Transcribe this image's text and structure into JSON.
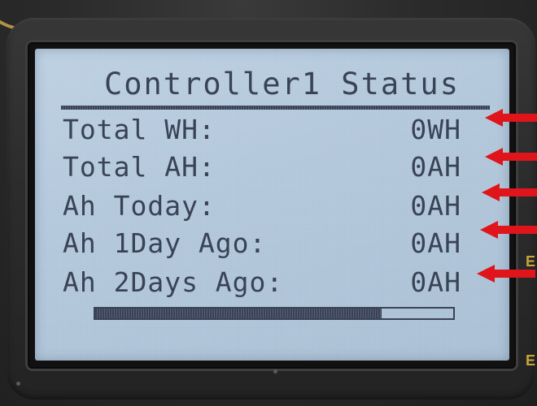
{
  "device": {
    "screen_title": "Controller1 Status",
    "rows": [
      {
        "label": "Total WH:",
        "value": "0WH"
      },
      {
        "label": "Total AH:",
        "value": "0AH"
      },
      {
        "label": "Ah Today:",
        "value": "0AH"
      },
      {
        "label": "Ah 1Day Ago:",
        "value": "0AH"
      },
      {
        "label": "Ah 2Days Ago:",
        "value": "0AH"
      }
    ],
    "progress_fraction": 0.8,
    "side_labels": [
      "E",
      "E"
    ],
    "colors": {
      "lcd_background": "#b2c7db",
      "lcd_text": "#3a4256",
      "bezel": "#2c2c2c",
      "annotation_arrow": "#e0141b",
      "side_label": "#c8a43a"
    },
    "annotation_arrows": [
      "arrow-icon",
      "arrow-icon",
      "arrow-icon",
      "arrow-icon",
      "arrow-icon"
    ]
  }
}
